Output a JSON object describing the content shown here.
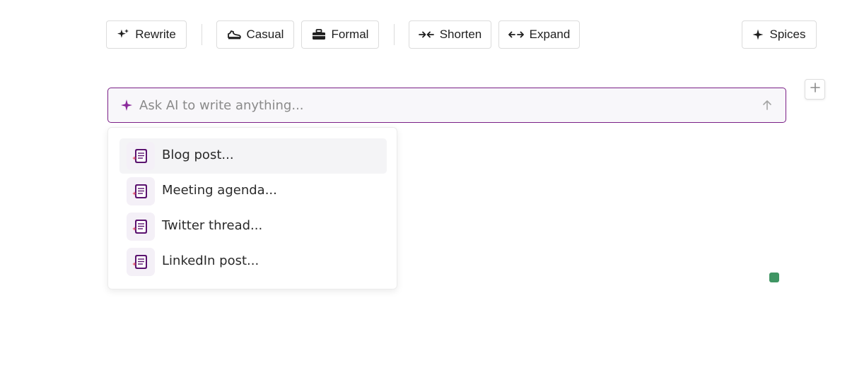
{
  "toolbar": {
    "rewrite_label": "Rewrite",
    "casual_label": "Casual",
    "formal_label": "Formal",
    "shorten_label": "Shorten",
    "expand_label": "Expand",
    "spices_label": "Spices"
  },
  "ai_prompt": {
    "placeholder": "Ask AI to write anything...",
    "value": ""
  },
  "suggestions": {
    "items": [
      {
        "label": "Blog post...",
        "icon": "document-sparkle-icon"
      },
      {
        "label": "Meeting agenda...",
        "icon": "document-sparkle-icon"
      },
      {
        "label": "Twitter thread...",
        "icon": "document-sparkle-icon"
      },
      {
        "label": "LinkedIn post...",
        "icon": "document-sparkle-icon"
      }
    ],
    "highlighted_index": 0
  },
  "colors": {
    "accent": "#7a1f86",
    "input_bg": "#f8f7fa",
    "status": "#3f9563"
  }
}
